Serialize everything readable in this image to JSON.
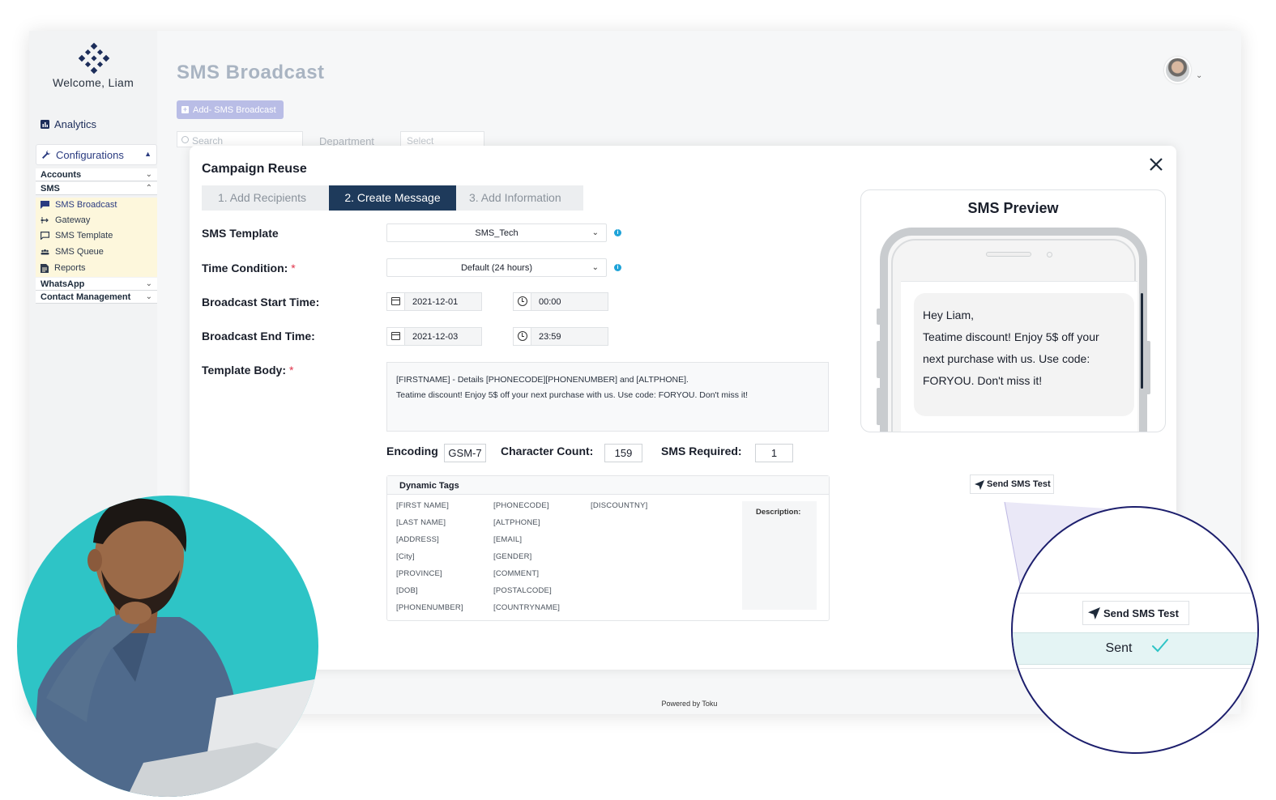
{
  "sidebar": {
    "welcome": "Welcome, Liam",
    "analytics": "Analytics",
    "configurations": "Configurations",
    "groups": {
      "accounts": "Accounts",
      "sms": "SMS",
      "whatsapp": "WhatsApp",
      "contact_management": "Contact Management"
    },
    "sms_items": [
      "SMS Broadcast",
      "Gateway",
      "SMS Template",
      "SMS Queue",
      "Reports"
    ]
  },
  "header": {
    "title": "SMS Broadcast",
    "add_button": "Add- SMS Broadcast",
    "search_placeholder": "Search",
    "department_label": "Department",
    "department_select": "Select"
  },
  "modal": {
    "title": "Campaign Reuse",
    "tabs": [
      "1. Add Recipients",
      "2. Create Message",
      "3. Add Information"
    ],
    "active_tab": "2. Create Message",
    "fields": {
      "sms_template_label": "SMS Template",
      "sms_template_value": "SMS_Tech",
      "time_condition_label": "Time Condition:",
      "time_condition_value": "Default (24 hours)",
      "start_label": "Broadcast Start Time:",
      "start_date": "2021-12-01",
      "start_time": "00:00",
      "end_label": "Broadcast End Time:",
      "end_date": "2021-12-03",
      "end_time": "23:59",
      "body_label": "Template Body:",
      "body_line1": "[FIRSTNAME] - Details [PHONECODE][PHONENUMBER] and [ALTPHONE].",
      "body_line2": "Teatime discount! Enjoy 5$ off your next purchase with us. Use code: FORYOU. Don't miss it!",
      "required_mark": "*"
    },
    "encoding": {
      "label": "Encoding",
      "value": "GSM-7",
      "char_label": "Character Count:",
      "char_value": "159",
      "sms_req_label": "SMS Required:",
      "sms_req_value": "1"
    },
    "dynamic_tags": {
      "title": "Dynamic Tags",
      "col1": [
        "[FIRST NAME]",
        "[LAST NAME]",
        "[ADDRESS]",
        "[City]",
        "[PROVINCE]",
        "[DOB]",
        "[PHONENUMBER]"
      ],
      "col2": [
        "[PHONECODE]",
        "[ALTPHONE]",
        "[EMAIL]",
        "[GENDER]",
        "[COMMENT]",
        "[POSTALCODE]",
        "[COUNTRYNAME]"
      ],
      "col3": [
        "[DISCOUNTNY]"
      ],
      "description_label": "Description:"
    },
    "preview": {
      "title": "SMS Preview",
      "line1": "Hey Liam,",
      "line2": "Teatime discount! Enjoy 5$ off your",
      "line3": "next purchase with us. Use code:",
      "line4": "FORYOU. Don't miss it!"
    },
    "send_test": "Send SMS Test"
  },
  "footer": {
    "powered": "Powered by Toku"
  },
  "zoom": {
    "send_test": "Send SMS Test",
    "status": "Sent"
  },
  "colors": {
    "accent": "#1e3a5b",
    "brand": "#2a3b80",
    "teal": "#2ec4c6",
    "sent_bg": "#e4f4f4",
    "info": "#1fa3d8",
    "required": "#e0334b"
  }
}
